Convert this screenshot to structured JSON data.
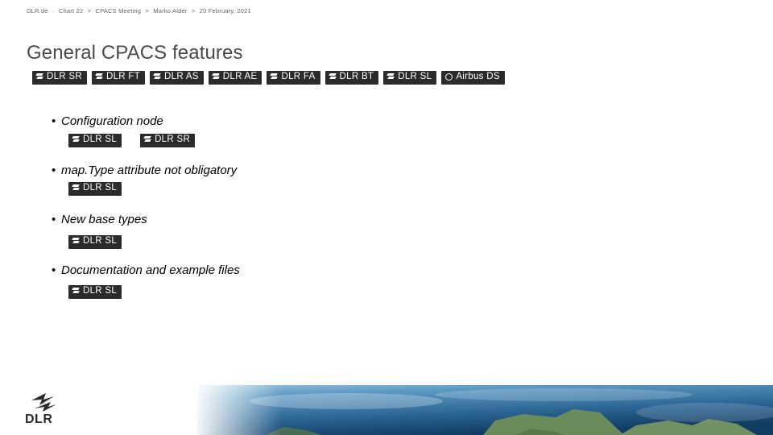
{
  "breadcrumb": {
    "items": [
      "DLR.de",
      "Chart 22",
      "CPACS Meeting",
      "Marko Alder",
      "20 February, 2021"
    ],
    "separator": ">"
  },
  "title": "General CPACS features",
  "tag_rows": [
    {
      "id": "row-top",
      "tags": [
        {
          "label": "DLR SR",
          "icon": "dlr-bird-icon"
        },
        {
          "label": "DLR FT",
          "icon": "dlr-bird-icon"
        },
        {
          "label": "DLR AS",
          "icon": "dlr-bird-icon"
        },
        {
          "label": "DLR AE",
          "icon": "dlr-bird-icon"
        },
        {
          "label": "DLR FA",
          "icon": "dlr-bird-icon"
        },
        {
          "label": "DLR BT",
          "icon": "dlr-bird-icon"
        },
        {
          "label": "DLR SL",
          "icon": "dlr-bird-icon"
        },
        {
          "label": "Airbus DS",
          "icon": "airbus-circle-icon"
        }
      ]
    },
    {
      "id": "row-1",
      "tags": [
        {
          "label": "DLR SL",
          "icon": "dlr-bird-icon"
        },
        {
          "label": "DLR SR",
          "icon": "dlr-bird-icon"
        }
      ]
    },
    {
      "id": "row-2",
      "tags": [
        {
          "label": "DLR SL",
          "icon": "dlr-bird-icon"
        }
      ]
    },
    {
      "id": "row-3",
      "tags": [
        {
          "label": "DLR SL",
          "icon": "dlr-bird-icon"
        }
      ]
    },
    {
      "id": "row-4",
      "tags": [
        {
          "label": "DLR SL",
          "icon": "dlr-bird-icon"
        }
      ]
    }
  ],
  "bullets": [
    {
      "text": "Configuration node",
      "marker": "•"
    },
    {
      "text": "map.Type attribute not obligatory",
      "marker": "•"
    },
    {
      "text": "New base types",
      "marker": "•"
    },
    {
      "text": "Documentation and example files",
      "marker": "•"
    }
  ],
  "logo": {
    "word": "DLR",
    "icon": "dlr-bird-logo-icon"
  },
  "colors": {
    "tag_background": "#2b2b2b",
    "title": "#4a4a4a",
    "breadcrumb": "#666666",
    "earth_ocean": "#2f6f9e",
    "earth_land": "#6f8f5a"
  }
}
